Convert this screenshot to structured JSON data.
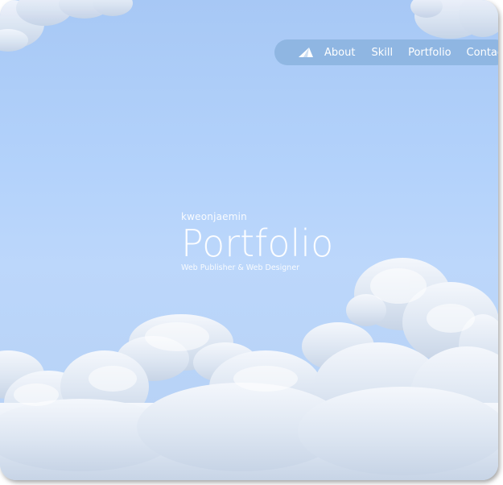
{
  "nav": {
    "logo_icon": "paper-plane-icon",
    "items": [
      {
        "label": "About"
      },
      {
        "label": "Skill"
      },
      {
        "label": "Portfolio"
      },
      {
        "label": "Contact"
      }
    ]
  },
  "hero": {
    "author": "kweonjaemin",
    "title": "Portfolio",
    "subtitle": "Web Publisher & Web Designer"
  },
  "colors": {
    "sky_top": "#a7c8f5",
    "sky_mid": "#bcd7fb",
    "nav_bg": "#78a5d2",
    "text": "#ffffff",
    "cloud": "#e9eef6"
  }
}
